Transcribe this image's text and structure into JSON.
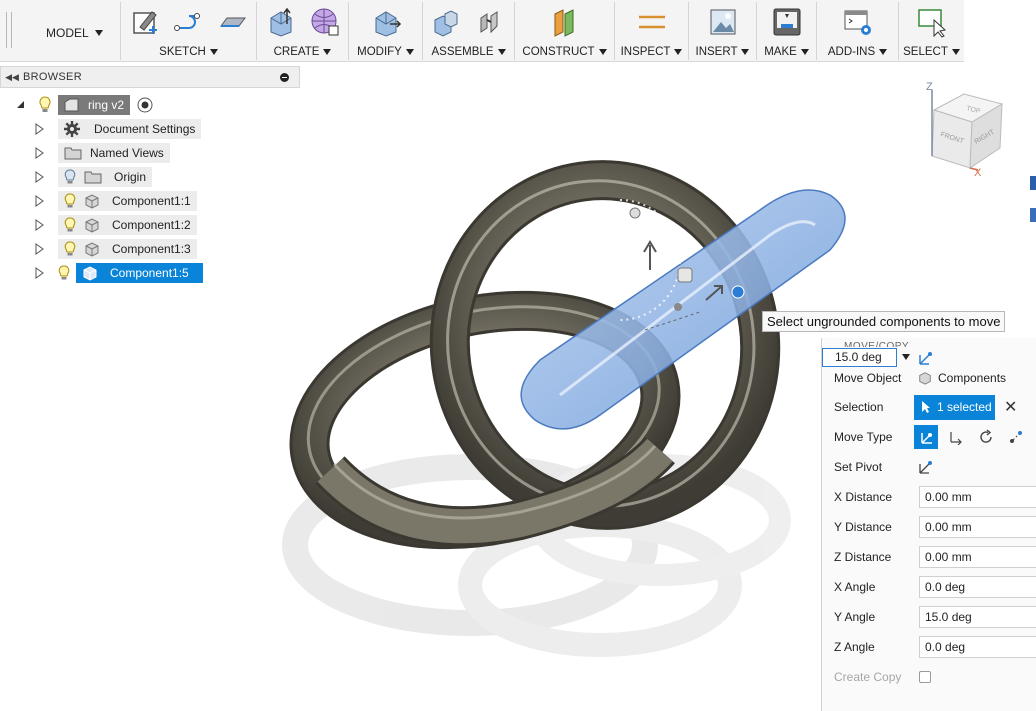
{
  "toolbar": {
    "workspace": "MODEL",
    "groups": [
      {
        "label": "SKETCH"
      },
      {
        "label": "CREATE"
      },
      {
        "label": "MODIFY"
      },
      {
        "label": "ASSEMBLE"
      },
      {
        "label": "CONSTRUCT"
      },
      {
        "label": "INSPECT"
      },
      {
        "label": "INSERT"
      },
      {
        "label": "MAKE"
      },
      {
        "label": "ADD-INS"
      },
      {
        "label": "SELECT"
      }
    ]
  },
  "browser": {
    "title": "BROWSER",
    "root": "ring v2",
    "items": [
      {
        "label": "Document Settings",
        "icon": "gear-icon"
      },
      {
        "label": "Named Views",
        "icon": "folder-icon"
      },
      {
        "label": "Origin",
        "icon": "folder-icon"
      },
      {
        "label": "Component1:1",
        "icon": "component-icon"
      },
      {
        "label": "Component1:2",
        "icon": "component-icon"
      },
      {
        "label": "Component1:3",
        "icon": "component-icon"
      },
      {
        "label": "Component1:5",
        "icon": "component-icon",
        "selected": true
      }
    ]
  },
  "viewcube": {
    "top": "TOP",
    "front": "FRONT",
    "right": "RIGHT",
    "axis_z": "Z",
    "axis_x": "X"
  },
  "tooltip": "Select ungrounded components to move",
  "dialog": {
    "title": "MOVE/COPY",
    "angle_value": "15.0 deg",
    "move_object_label": "Move Object",
    "move_object_value": "Components",
    "selection_label": "Selection",
    "selection_value": "1 selected",
    "move_type_label": "Move Type",
    "set_pivot_label": "Set Pivot",
    "fields": [
      {
        "label": "X Distance",
        "value": "0.00 mm"
      },
      {
        "label": "Y Distance",
        "value": "0.00 mm"
      },
      {
        "label": "Z Distance",
        "value": "0.00 mm"
      },
      {
        "label": "X Angle",
        "value": "0.0 deg"
      },
      {
        "label": "Y Angle",
        "value": "15.0 deg"
      },
      {
        "label": "Z Angle",
        "value": "0.0 deg"
      }
    ],
    "create_copy_label": "Create Copy"
  },
  "colors": {
    "accent": "#0a84d8",
    "ring": "#6e6a5e",
    "selected_ring": "#8fb4e6"
  }
}
